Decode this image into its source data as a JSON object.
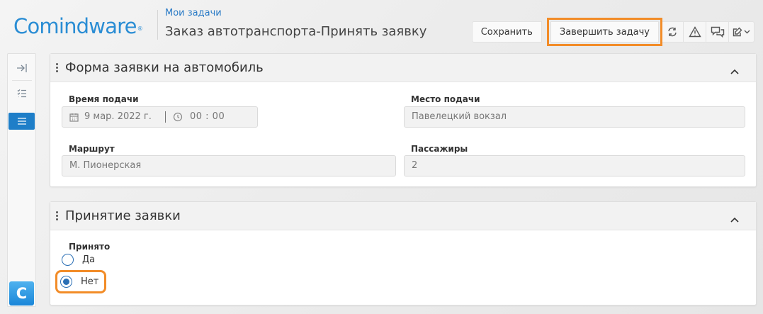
{
  "header": {
    "logo_text": "Comindware",
    "logo_mark": "®",
    "breadcrumb": "Мои задачи",
    "title": "Заказ автотранспорта-Принять заявку"
  },
  "toolbar": {
    "save_label": "Сохранить",
    "finish_label": "Завершить задачу",
    "icons": [
      "refresh-icon",
      "warning-icon",
      "chat-icon",
      "edit-icon",
      "chevron-down-icon"
    ]
  },
  "rail": {
    "items": [
      "expand-icon",
      "checklist-icon",
      "menu-icon"
    ],
    "active_index": 2,
    "app_letter": "C"
  },
  "form_panel": {
    "title": "Форма заявки на автомобиль",
    "fields": {
      "time_label": "Время подачи",
      "date_value": "9 мар. 2022 г.",
      "time_value": "00 : 00",
      "place_label": "Место подачи",
      "place_value": "Павелецкий вокзал",
      "route_label": "Маршрут",
      "route_value": "М. Пионерская",
      "passengers_label": "Пассажиры",
      "passengers_value": "2"
    }
  },
  "accept_panel": {
    "title": "Принятие заявки",
    "question_label": "Принято",
    "options": [
      "Да",
      "Нет"
    ],
    "selected": "Нет"
  },
  "colors": {
    "brand": "#2a8dd4",
    "accent_highlight": "#f28c28",
    "active": "#1e7ec8"
  }
}
